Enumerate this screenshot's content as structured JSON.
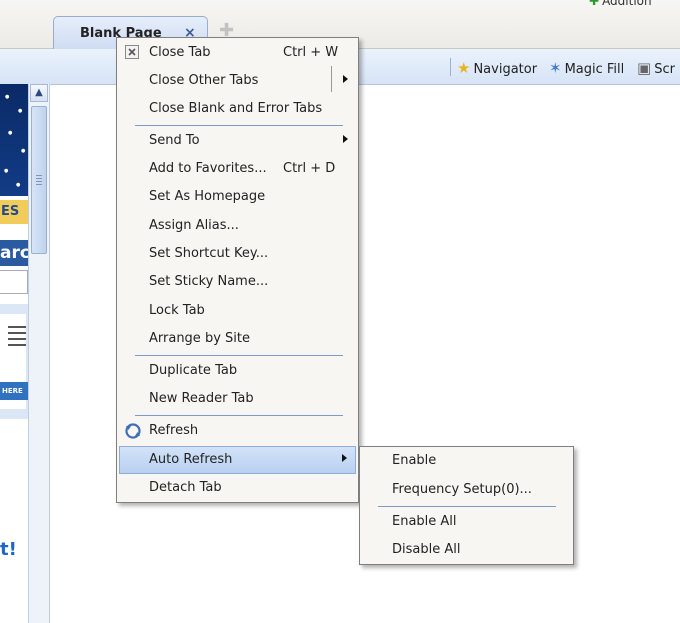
{
  "tab": {
    "title": "Blank Page",
    "close": "×"
  },
  "header": {
    "addition": "Addition"
  },
  "toolbar": {
    "navigator": "Navigator",
    "magic_fill": "Magic Fill",
    "scr": "Scr"
  },
  "left": {
    "es": "ES",
    "arc": "arc",
    "here": "HERE",
    "t": "t!"
  },
  "menu": {
    "items": [
      {
        "label": "Close Tab",
        "shortcut": "Ctrl + W"
      },
      {
        "label": "Close Other Tabs"
      },
      {
        "label": "Close Blank and Error Tabs"
      },
      {
        "label": "Send To"
      },
      {
        "label": "Add to Favorites...",
        "shortcut": "Ctrl + D"
      },
      {
        "label": "Set As Homepage"
      },
      {
        "label": "Assign Alias..."
      },
      {
        "label": "Set Shortcut Key..."
      },
      {
        "label": "Set Sticky Name..."
      },
      {
        "label": "Lock Tab"
      },
      {
        "label": "Arrange by Site"
      },
      {
        "label": "Duplicate Tab"
      },
      {
        "label": "New Reader Tab"
      },
      {
        "label": "Refresh"
      },
      {
        "label": "Auto Refresh"
      },
      {
        "label": "Detach Tab"
      }
    ]
  },
  "submenu": {
    "items": [
      {
        "label": "Enable"
      },
      {
        "label": "Frequency Setup(0)..."
      },
      {
        "label": "Enable All"
      },
      {
        "label": "Disable All"
      }
    ]
  }
}
